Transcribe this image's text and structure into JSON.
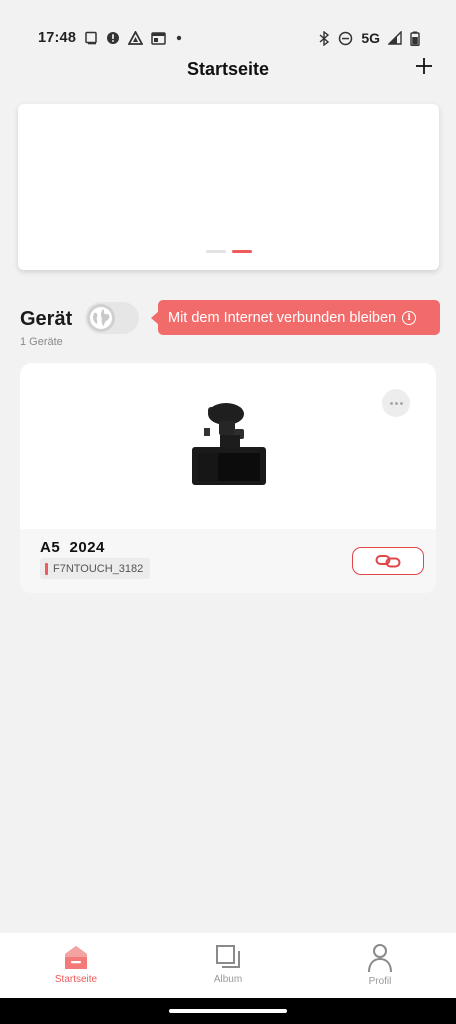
{
  "status_bar": {
    "time": "17:48",
    "network": "5G",
    "icons_left": [
      "screen-icon",
      "alert-icon",
      "drive-icon",
      "calendar-icon",
      "dot-icon"
    ],
    "icons_right": [
      "bluetooth-icon",
      "dnd-icon",
      "signal-icon",
      "battery-icon"
    ]
  },
  "header": {
    "title": "Startseite",
    "add_icon": "plus-icon"
  },
  "banner": {
    "pages": 2,
    "active_page": 2,
    "active_color": "#f05a5a"
  },
  "devices": {
    "title": "Gerät",
    "count_label": "1 Geräte",
    "tooltip": "Mit dem Internet verbunden bleiben",
    "toggle_on": false
  },
  "device_card": {
    "model": "A5  2024",
    "wifi_name": "F7NTOUCH_3182",
    "more_icon": "more-icon",
    "connect_icon": "link-icon"
  },
  "bottom_nav": {
    "items": [
      {
        "label": "Startseite",
        "icon": "home-icon",
        "active": true
      },
      {
        "label": "Album",
        "icon": "album-icon",
        "active": false
      },
      {
        "label": "Profil",
        "icon": "profile-icon",
        "active": false
      }
    ],
    "accent": "#f05a5a"
  }
}
